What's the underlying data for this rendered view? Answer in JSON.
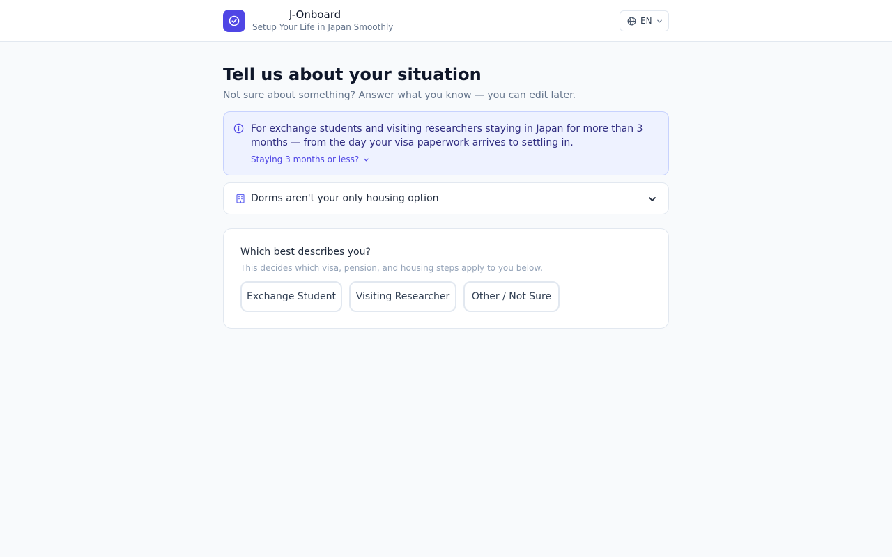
{
  "header": {
    "brand_title": "J-Onboard",
    "brand_subtitle": "Setup Your Life in Japan Smoothly",
    "language": "EN",
    "logo_icon": "check-circle-icon",
    "accent_color": "#4f46e5"
  },
  "main": {
    "title": "Tell us about your situation",
    "subtitle": "Not sure about something? Answer what you know — you can edit later.",
    "info": {
      "icon": "info-icon",
      "text": "For exchange students and visiting researchers staying in Japan for more than 3 months — from the day your visa paperwork arrives to settling in.",
      "toggle_label": "Staying 3 months or less?"
    },
    "housing_accordion": {
      "icon": "building-icon",
      "label": "Dorms aren't your only housing option"
    },
    "question_card": {
      "question": "Which best describes you?",
      "hint": "This decides which visa, pension, and housing steps apply to you below.",
      "options": [
        {
          "label": "Exchange Student"
        },
        {
          "label": "Visiting Researcher"
        },
        {
          "label": "Other / Not Sure"
        }
      ]
    }
  }
}
